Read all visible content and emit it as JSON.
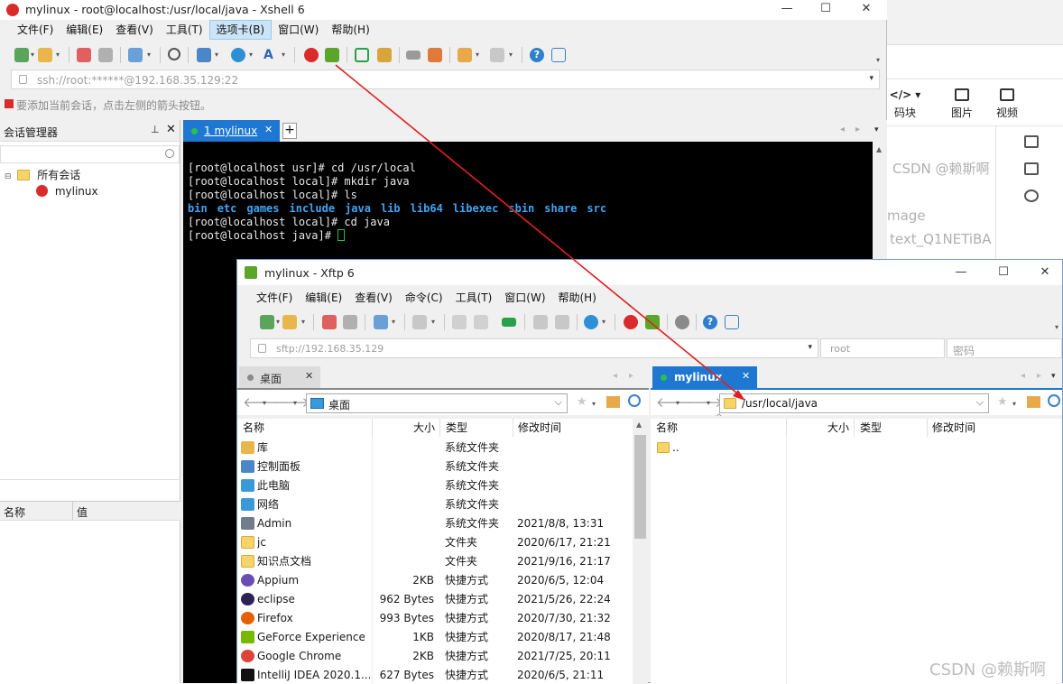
{
  "background": {
    "toolbar": [
      {
        "label": "码块",
        "icon": "code-icon"
      },
      {
        "label": "图片",
        "icon": "image-icon"
      },
      {
        "label": "视频",
        "icon": "video-icon"
      }
    ],
    "faint_texts": [
      "CSDN @赖斯啊",
      "mage",
      "text_Q1NETiBA"
    ],
    "watermark": "CSDN @赖斯啊"
  },
  "xshell": {
    "title": "mylinux - root@localhost:/usr/local/java - Xshell 6",
    "menu": [
      "文件(F)",
      "编辑(E)",
      "查看(V)",
      "工具(T)",
      "选项卡(B)",
      "窗口(W)",
      "帮助(H)"
    ],
    "active_menu_index": 4,
    "address": "ssh://root:******@192.168.35.129:22",
    "hint": "要添加当前会话，点击左侧的箭头按钮。",
    "session_manager": {
      "title": "会话管理器",
      "root": "所有会话",
      "sessions": [
        "mylinux"
      ],
      "props_headers": [
        "名称",
        "值"
      ]
    },
    "tab": {
      "label": "1 mylinux"
    },
    "terminal": {
      "lines": [
        "[root@localhost usr]# cd /usr/local",
        "[root@localhost local]# mkdir java",
        "[root@localhost local]# ls"
      ],
      "ls_output": [
        "bin",
        "etc",
        "games",
        "include",
        "java",
        "lib",
        "lib64",
        "libexec",
        "sbin",
        "share",
        "src"
      ],
      "lines_after": [
        "[root@localhost local]# cd java",
        "[root@localhost java]# "
      ]
    }
  },
  "xftp": {
    "title": "mylinux - Xftp 6",
    "menu": [
      "文件(F)",
      "编辑(E)",
      "查看(V)",
      "命令(C)",
      "工具(T)",
      "窗口(W)",
      "帮助(H)"
    ],
    "address": "sftp://192.168.35.129",
    "user": "root",
    "password_placeholder": "密码",
    "local": {
      "tab": "桌面",
      "path": "桌面",
      "columns": [
        "名称",
        "大小",
        "类型",
        "修改时间"
      ],
      "files": [
        {
          "name": "库",
          "size": "",
          "type": "系统文件夹",
          "modified": "",
          "icon": "library-icon",
          "color": "#e8b64a"
        },
        {
          "name": "控制面板",
          "size": "",
          "type": "系统文件夹",
          "modified": "",
          "icon": "control-panel-icon",
          "color": "#4a86c8"
        },
        {
          "name": "此电脑",
          "size": "",
          "type": "系统文件夹",
          "modified": "",
          "icon": "computer-icon",
          "color": "#3a9ad9"
        },
        {
          "name": "网络",
          "size": "",
          "type": "系统文件夹",
          "modified": "",
          "icon": "network-icon",
          "color": "#3a9ad9"
        },
        {
          "name": "Admin",
          "size": "",
          "type": "系统文件夹",
          "modified": "2021/8/8, 13:31",
          "icon": "user-icon",
          "color": "#6f7e8a"
        },
        {
          "name": "jc",
          "size": "",
          "type": "文件夹",
          "modified": "2020/6/17, 21:21",
          "icon": "folder-icon",
          "color": "#f6d469"
        },
        {
          "name": "知识点文档",
          "size": "",
          "type": "文件夹",
          "modified": "2021/9/16, 21:17",
          "icon": "folder-icon",
          "color": "#f6d469"
        },
        {
          "name": "Appium",
          "size": "2KB",
          "type": "快捷方式",
          "modified": "2020/6/5, 12:04",
          "icon": "appium-icon",
          "color": "#6a4fb3"
        },
        {
          "name": "eclipse",
          "size": "962 Bytes",
          "type": "快捷方式",
          "modified": "2021/5/26, 22:24",
          "icon": "eclipse-icon",
          "color": "#2c2255"
        },
        {
          "name": "Firefox",
          "size": "993 Bytes",
          "type": "快捷方式",
          "modified": "2020/7/30, 21:32",
          "icon": "firefox-icon",
          "color": "#e66000"
        },
        {
          "name": "GeForce Experience",
          "size": "1KB",
          "type": "快捷方式",
          "modified": "2020/8/17, 21:48",
          "icon": "geforce-icon",
          "color": "#76b900"
        },
        {
          "name": "Google Chrome",
          "size": "2KB",
          "type": "快捷方式",
          "modified": "2021/7/25, 20:11",
          "icon": "chrome-icon",
          "color": "#db4437"
        },
        {
          "name": "IntelliJ IDEA 2020.1....",
          "size": "627 Bytes",
          "type": "快捷方式",
          "modified": "2020/6/5, 21:11",
          "icon": "intellij-icon",
          "color": "#111111"
        }
      ]
    },
    "remote": {
      "tab": "mylinux",
      "path": "/usr/local/java",
      "columns": [
        "名称",
        "大小",
        "类型",
        "修改时间"
      ],
      "files": [
        {
          "name": "..",
          "icon": "folder-icon"
        }
      ]
    }
  },
  "colors": {
    "accent": "#1e78d2",
    "terminal_bg": "#000000",
    "dir_blue": "#3ea5f5",
    "annotation_red": "#e02020"
  }
}
